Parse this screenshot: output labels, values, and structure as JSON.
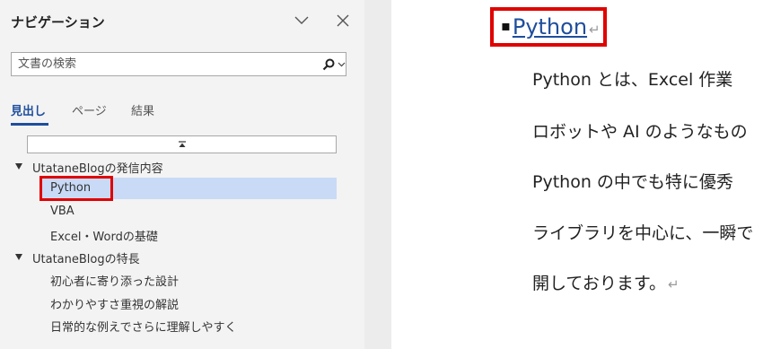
{
  "nav": {
    "title": "ナビゲーション",
    "search": {
      "placeholder": "文書の検索"
    },
    "tabs": [
      {
        "label": "見出し",
        "active": true
      },
      {
        "label": "ページ",
        "active": false
      },
      {
        "label": "結果",
        "active": false
      }
    ],
    "tree": [
      {
        "label": "UtataneBlogの発信内容",
        "level": 1
      },
      {
        "label": "Python",
        "level": 2,
        "selected": true
      },
      {
        "label": "VBA",
        "level": 2
      },
      {
        "label": "Excel・Wordの基礎",
        "level": 2
      },
      {
        "label": "UtataneBlogの特長",
        "level": 1
      },
      {
        "label": "初心者に寄り添った設計",
        "level": 2
      },
      {
        "label": "わかりやすさ重視の解説",
        "level": 2
      },
      {
        "label": "日常的な例えでさらに理解しやすく",
        "level": 2
      }
    ]
  },
  "document": {
    "heading_bullet": "▪",
    "heading": "Python",
    "paragraphs": [
      "Python とは、Excel 作業",
      "ロボットや AI のようなもの",
      "Python の中でも特に優秀",
      "ライブラリを中心に、一瞬で",
      "開しております。"
    ],
    "return_mark": "↵"
  },
  "colors": {
    "accent": "#1e4e9c",
    "selection": "#c8daf6",
    "highlight_border": "#e00000"
  },
  "icons": [
    "chevron-down-icon",
    "close-icon",
    "search-icon",
    "dropdown-arrow-icon",
    "collapse-up-icon",
    "expand-triangle-icon"
  ]
}
